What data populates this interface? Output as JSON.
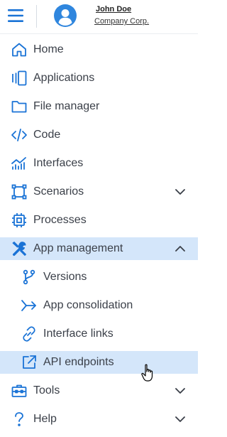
{
  "header": {
    "user_name": "John Doe",
    "company": "Company Corp.",
    "menu_icon": "hamburger-menu-icon",
    "avatar_icon": "user-avatar-icon"
  },
  "colors": {
    "accent": "#1a73d6",
    "selected_bg": "#d4e6fa",
    "text": "#3a3f48"
  },
  "menu": {
    "home": "Home",
    "applications": "Applications",
    "file_manager": "File manager",
    "code": "Code",
    "interfaces": "Interfaces",
    "scenarios": "Scenarios",
    "processes": "Processes",
    "app_management": "App management",
    "versions": "Versions",
    "app_consolidation": "App consolidation",
    "interface_links": "Interface links",
    "api_endpoints": "API endpoints",
    "tools": "Tools",
    "help": "Help"
  }
}
